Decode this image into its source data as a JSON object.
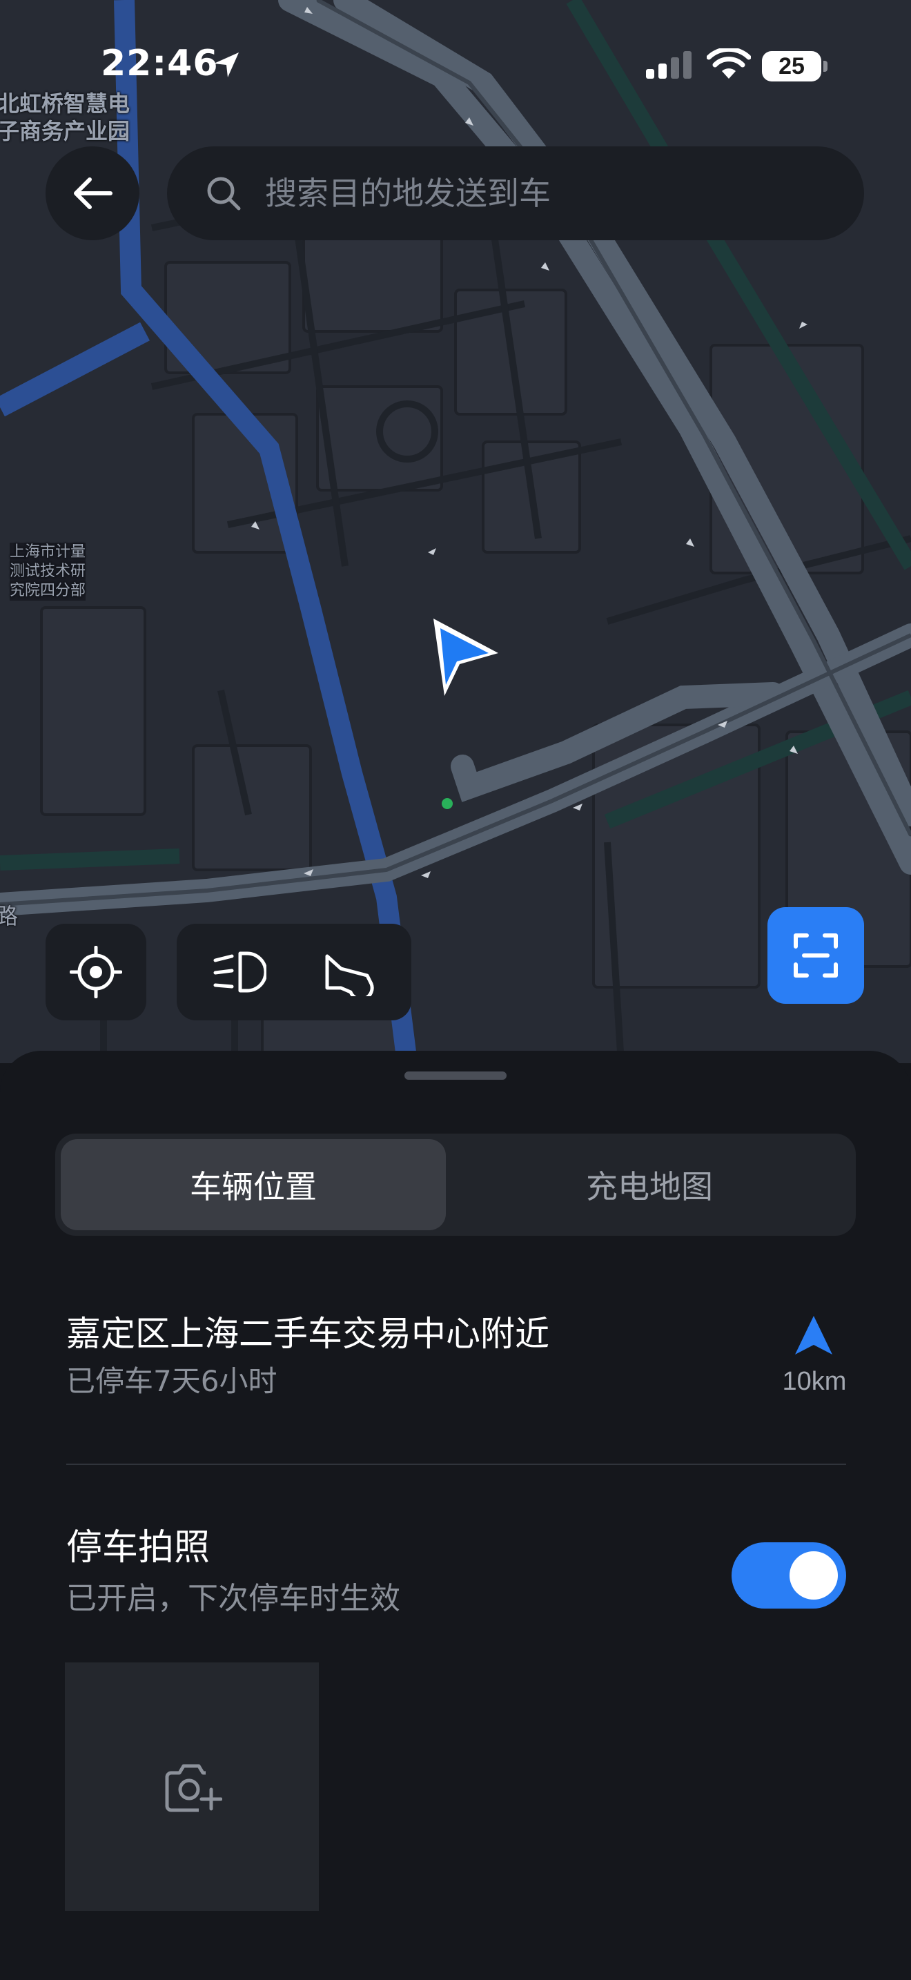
{
  "status_bar": {
    "time": "22:46",
    "battery": "25"
  },
  "map": {
    "labels": {
      "top_area": [
        "北虹桥智慧电",
        "子商务产业园"
      ],
      "institute": [
        "上海市计量",
        "测试技术研",
        "究院四分部"
      ],
      "road": "路"
    }
  },
  "search": {
    "placeholder": "搜索目的地发送到车"
  },
  "icons": {
    "back": "arrow-left-icon",
    "search": "search-icon",
    "locate": "crosshair-icon",
    "headlight": "headlight-icon",
    "horn": "horn-icon",
    "scan": "scan-icon",
    "navigate": "navigation-arrow-icon",
    "camera": "camera-plus-icon",
    "car": "car-location-arrow-icon"
  },
  "colors": {
    "accent": "#2a7ef5",
    "map_background": "#272b34",
    "sheet_background": "#15171c"
  },
  "tabs": [
    {
      "label": "车辆位置",
      "active": true
    },
    {
      "label": "充电地图",
      "active": false
    }
  ],
  "vehicle": {
    "location": "嘉定区上海二手车交易中心附近",
    "parked_duration": "已停车7天6小时",
    "distance": "10km"
  },
  "parking_photo": {
    "title": "停车拍照",
    "status": "已开启，下次停车时生效",
    "enabled": true
  }
}
